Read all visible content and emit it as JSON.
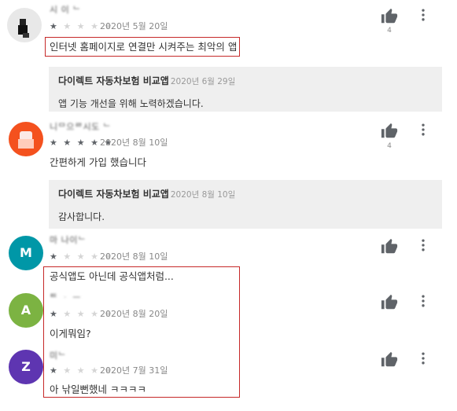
{
  "reviews": [
    {
      "name": "시 이 ᄂ",
      "rating": 1,
      "stars_on": "★",
      "stars_off": "★ ★ ★ ★",
      "date": "2020년 5월 20일",
      "text": "인터넷 홈페이지로 연결만 시켜주는 최악의 앱",
      "likes": "4",
      "avatar_color": "#e8e8e8",
      "reply": {
        "developer": "다이렉트 자동차보험 비교앱",
        "date": "2020년 6월 29일",
        "text": "앱 기능 개선을 위해 노력하겠습니다."
      }
    },
    {
      "name": "니ᄆ으ᄅ시도 ᄂ",
      "rating": 5,
      "stars_on": "★ ★ ★ ★ ★",
      "stars_off": "",
      "date": "2020년 8월 10일",
      "text": "간편하게 가입 했습니다",
      "likes": "4",
      "avatar_color": "#f4511e",
      "reply": {
        "developer": "다이렉트 자동차보험 비교앱",
        "date": "2020년 8월 10일",
        "text": "감사합니다."
      }
    },
    {
      "name": "마 나이ᄂ",
      "rating": 1,
      "stars_on": "★",
      "stars_off": "★ ★ ★ ★",
      "date": "2020년 8월 10일",
      "text": "공식앱도 아닌데 공식앱처럼...",
      "likes": "",
      "avatar_color": "#0097a7"
    },
    {
      "name": "ᄐ ᆞ ᅳ",
      "rating": 1,
      "stars_on": "★",
      "stars_off": "★ ★ ★ ★",
      "date": "2020년 8월 20일",
      "text": "이게뭐임?",
      "likes": "",
      "avatar_color": "#7cb342"
    },
    {
      "name": "미ᄂ",
      "rating": 1,
      "stars_on": "★",
      "stars_off": "★ ★ ★ ★",
      "date": "2020년 7월 31일",
      "text": "아 낚일뻔했네 ㅋㅋㅋㅋ",
      "likes": "",
      "avatar_color": "#5e35b1"
    }
  ],
  "colors": {
    "highlight_border": "#c62828",
    "reply_background": "#efefef"
  },
  "icons": {
    "like": "thumbs-up-icon",
    "more": "more-vert-icon"
  }
}
